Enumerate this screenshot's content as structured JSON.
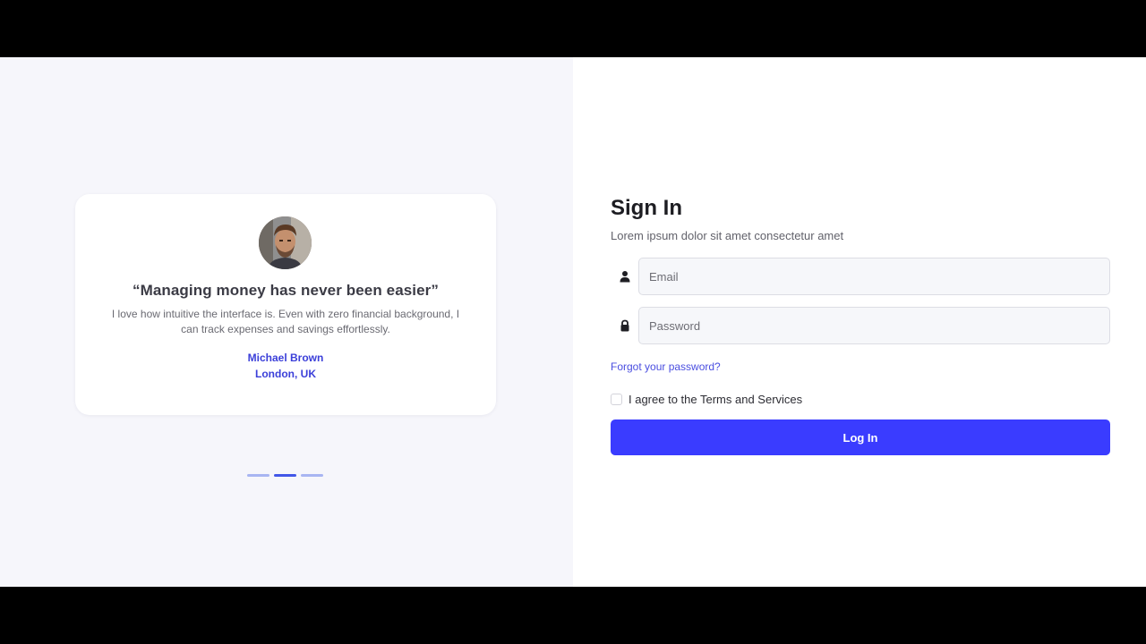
{
  "testimonial": {
    "quote_title": "“Managing money has never been easier”",
    "quote_body": "I love how intuitive the interface is. Even with zero financial background, I can track expenses and savings effortlessly.",
    "author_name": "Michael Brown",
    "author_location": "London, UK"
  },
  "carousel": {
    "dot_count": 3,
    "active_index": 1
  },
  "signin": {
    "title": "Sign In",
    "subtitle": "Lorem ipsum dolor sit amet consectetur amet",
    "email_placeholder": "Email",
    "email_value": "",
    "password_placeholder": "Password",
    "password_value": "",
    "forgot_label": "Forgot your password?",
    "agree_label": "I agree to the Terms and Services",
    "agree_checked": false,
    "login_label": "Log In",
    "email_icon": "user-icon",
    "password_icon": "lock-icon"
  },
  "colors": {
    "accent": "#3a3cff",
    "link": "#4a4ee0",
    "left_background": "#f6f6fb",
    "dot_active": "#4257e8",
    "dot_inactive": "#a8b5f2"
  }
}
